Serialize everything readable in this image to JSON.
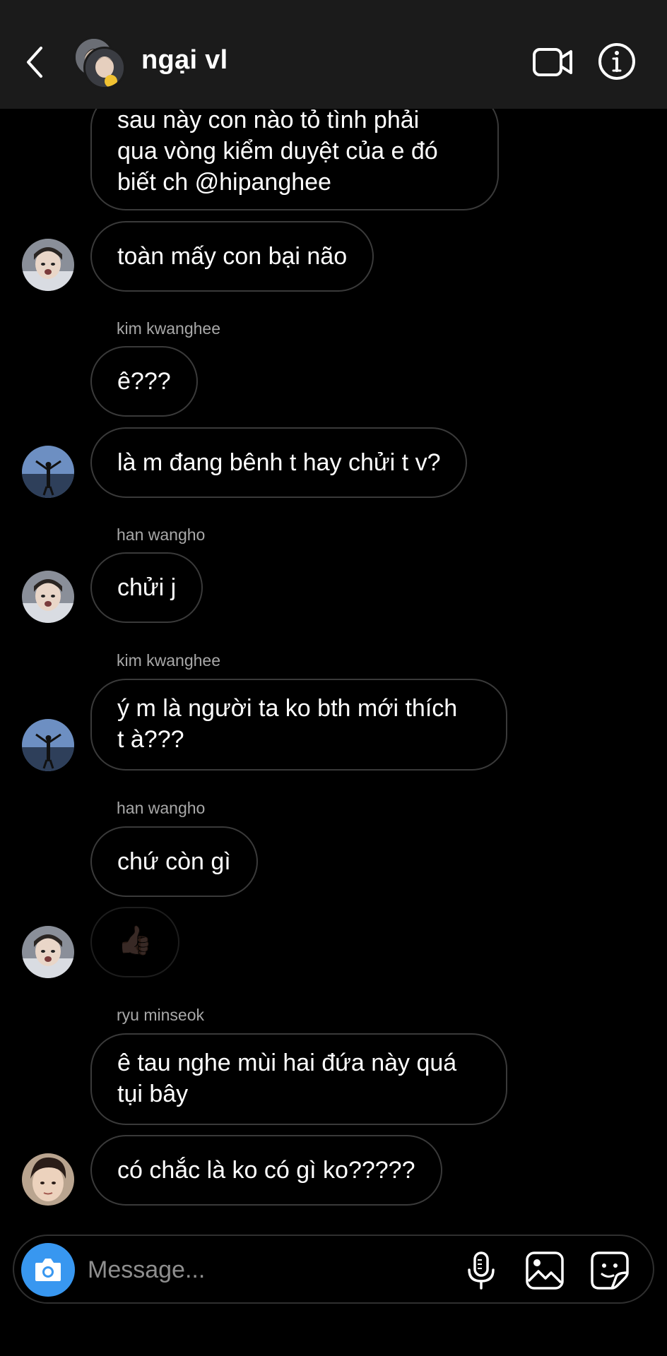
{
  "header": {
    "title": "ngại vl"
  },
  "messages": [
    {
      "text": "sau này con nào tỏ tình phải\nqua vòng kiểm duyệt của e đó\nbiết ch @hipanghee"
    },
    {
      "text": "toàn mấy con bại não"
    },
    {
      "sender": "kim kwanghee",
      "text": "ê???"
    },
    {
      "text": "là m đang bênh t hay chửi t v?"
    },
    {
      "sender": "han wangho",
      "text": "chửi j"
    },
    {
      "sender": "kim kwanghee",
      "text": "ý m là người ta ko bth mới thích\nt à???"
    },
    {
      "sender": "han wangho",
      "text": "chứ còn gì"
    },
    {
      "text": "👍🏿"
    },
    {
      "sender": "ryu minseok",
      "text": "ê tau nghe mùi hai đứa này quá\ntụi bây"
    },
    {
      "text": "có chắc là ko có gì ko?????"
    }
  ],
  "composer": {
    "placeholder": "Message...",
    "value": ""
  },
  "icons": {
    "back": "chevron-left-icon",
    "video": "video-camera-icon",
    "info": "info-icon",
    "camera": "camera-icon",
    "mic": "microphone-icon",
    "gallery": "image-icon",
    "sticker": "sticker-icon"
  },
  "colors": {
    "background": "#000000",
    "header": "#1b1b1b",
    "bubble_border": "#3a3a3a",
    "accent": "#3897f0",
    "sender_label": "#a8a8a8"
  }
}
